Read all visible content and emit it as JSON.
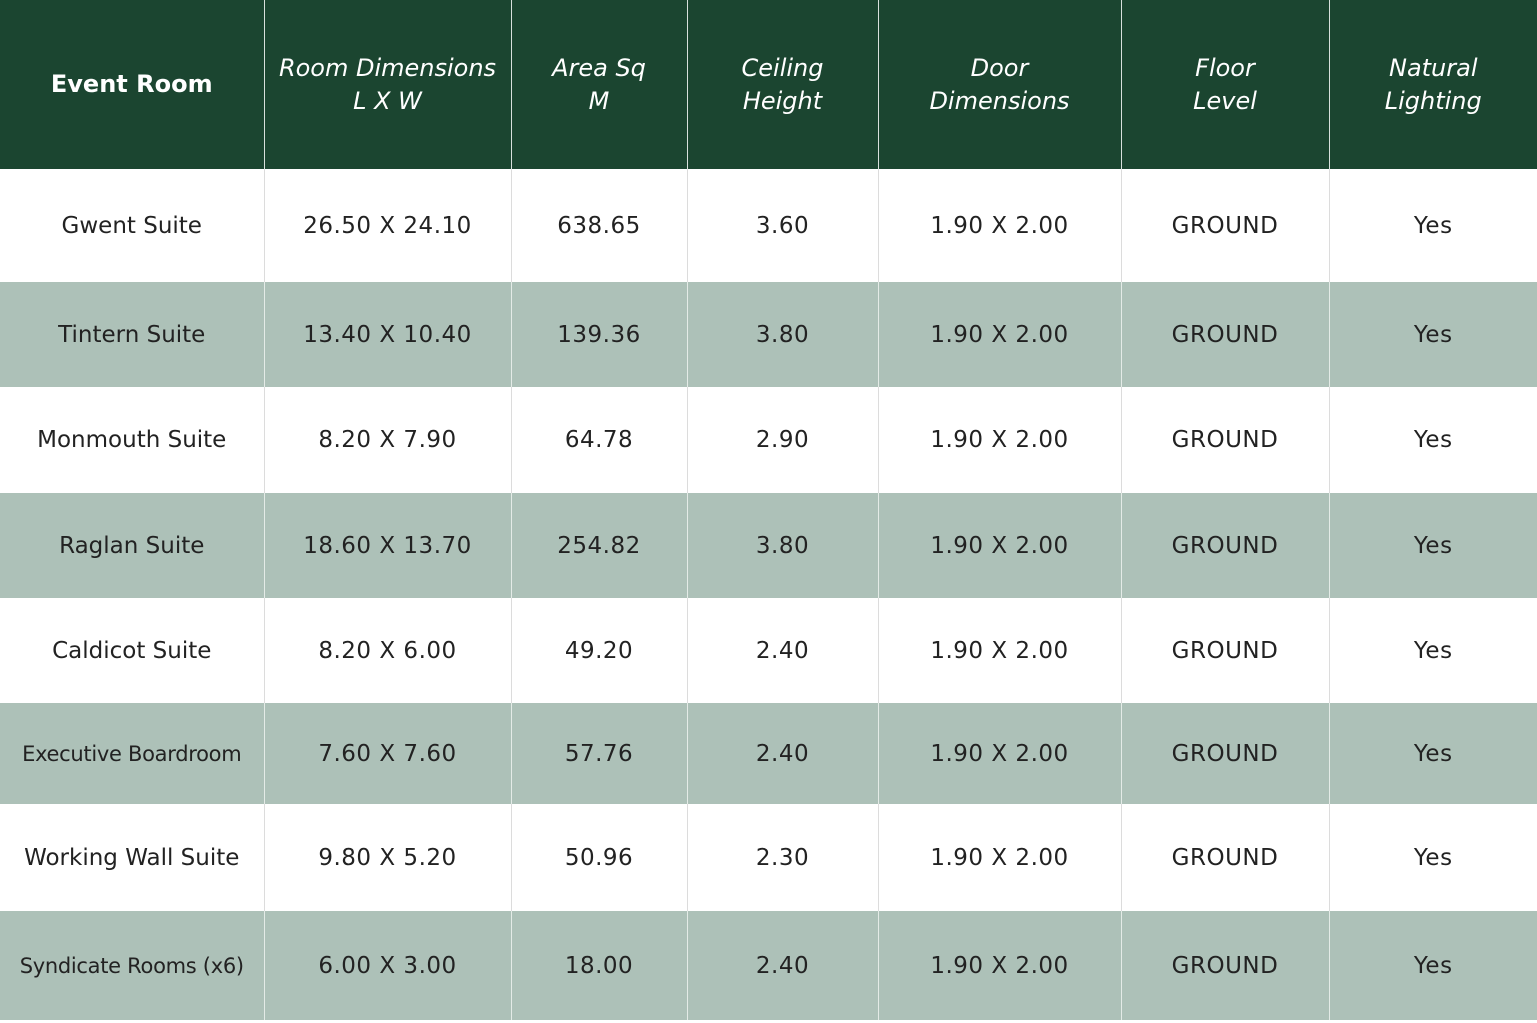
{
  "table": {
    "headers": [
      [
        "Event Room"
      ],
      [
        "Room Dimensions",
        "L X W"
      ],
      [
        "Area Sq",
        "M"
      ],
      [
        "Ceiling",
        "Height"
      ],
      [
        "Door",
        "Dimensions"
      ],
      [
        "Floor",
        "Level"
      ],
      [
        "Natural",
        "Lighting"
      ]
    ],
    "rows": [
      [
        "Gwent Suite",
        "26.50 X 24.10",
        "638.65",
        "3.60",
        "1.90 X 2.00",
        "GROUND",
        "Yes"
      ],
      [
        "Tintern Suite",
        "13.40 X 10.40",
        "139.36",
        "3.80",
        "1.90 X 2.00",
        "GROUND",
        "Yes"
      ],
      [
        "Monmouth Suite",
        "8.20 X 7.90",
        "64.78",
        "2.90",
        "1.90 X 2.00",
        "GROUND",
        "Yes"
      ],
      [
        "Raglan Suite",
        "18.60 X 13.70",
        "254.82",
        "3.80",
        "1.90 X 2.00",
        "GROUND",
        "Yes"
      ],
      [
        "Caldicot Suite",
        "8.20 X 6.00",
        "49.20",
        "2.40",
        "1.90 X 2.00",
        "GROUND",
        "Yes"
      ],
      [
        "Executive Boardroom",
        "7.60 X 7.60",
        "57.76",
        "2.40",
        "1.90 X 2.00",
        "GROUND",
        "Yes"
      ],
      [
        "Working Wall Suite",
        "9.80 X 5.20",
        "50.96",
        "2.30",
        "1.90 X 2.00",
        "GROUND",
        "Yes"
      ],
      [
        "Syndicate Rooms (x6)",
        "6.00 X 3.00",
        "18.00",
        "2.40",
        "1.90 X 2.00",
        "GROUND",
        "Yes"
      ]
    ]
  },
  "colors": {
    "header_bg": "#1b4530",
    "header_text": "#ffffff",
    "row_alt_bg": "#adc1b8",
    "row_bg": "#ffffff",
    "cell_text": "#222222"
  }
}
